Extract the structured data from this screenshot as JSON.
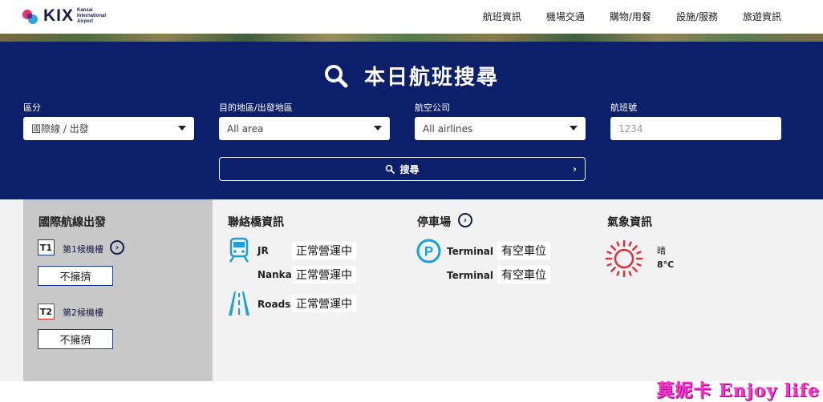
{
  "header": {
    "logo_text": "KIX",
    "logo_sub_lines": [
      "Kansai",
      "International",
      "Airport"
    ],
    "nav": [
      "航班資訊",
      "機場交通",
      "購物/用餐",
      "設施/服務",
      "旅遊資訊"
    ]
  },
  "search": {
    "title": "本日航班搜尋",
    "fields": [
      {
        "label": "區分",
        "value": "國際線 / 出發"
      },
      {
        "label": "目的地區/出發地區",
        "value": "All area"
      },
      {
        "label": "航空公司",
        "value": "All airlines"
      },
      {
        "label": "航班號",
        "placeholder": "1234"
      }
    ],
    "button_label": "搜尋"
  },
  "departures": {
    "title": "國際航線出發",
    "terminals": [
      {
        "badge": "T1",
        "label": "第1候機樓",
        "status": "不擁擠"
      },
      {
        "badge": "T2",
        "label": "第2候機樓",
        "status": "不擁擠"
      }
    ]
  },
  "bridge": {
    "title": "聯絡橋資訊",
    "items": [
      {
        "name": "JR",
        "status": "正常營運中"
      },
      {
        "name": "Nankai",
        "status": "正常營運中"
      },
      {
        "name": "Roads",
        "status": "正常營運中"
      }
    ]
  },
  "parking": {
    "title": "停車場",
    "items": [
      {
        "name": "Terminal 1",
        "status": "有空車位"
      },
      {
        "name": "Terminal 2",
        "status": "有空車位"
      }
    ]
  },
  "weather": {
    "title": "氣象資訊",
    "condition": "晴",
    "temperature": "8°C"
  },
  "watermark": "莫妮卡 Enjoy life",
  "colors": {
    "navy": "#0b1f6b",
    "accent_blue": "#1aa0d8",
    "sun_red": "#e0303a",
    "logo_pink": "#e5336f"
  }
}
